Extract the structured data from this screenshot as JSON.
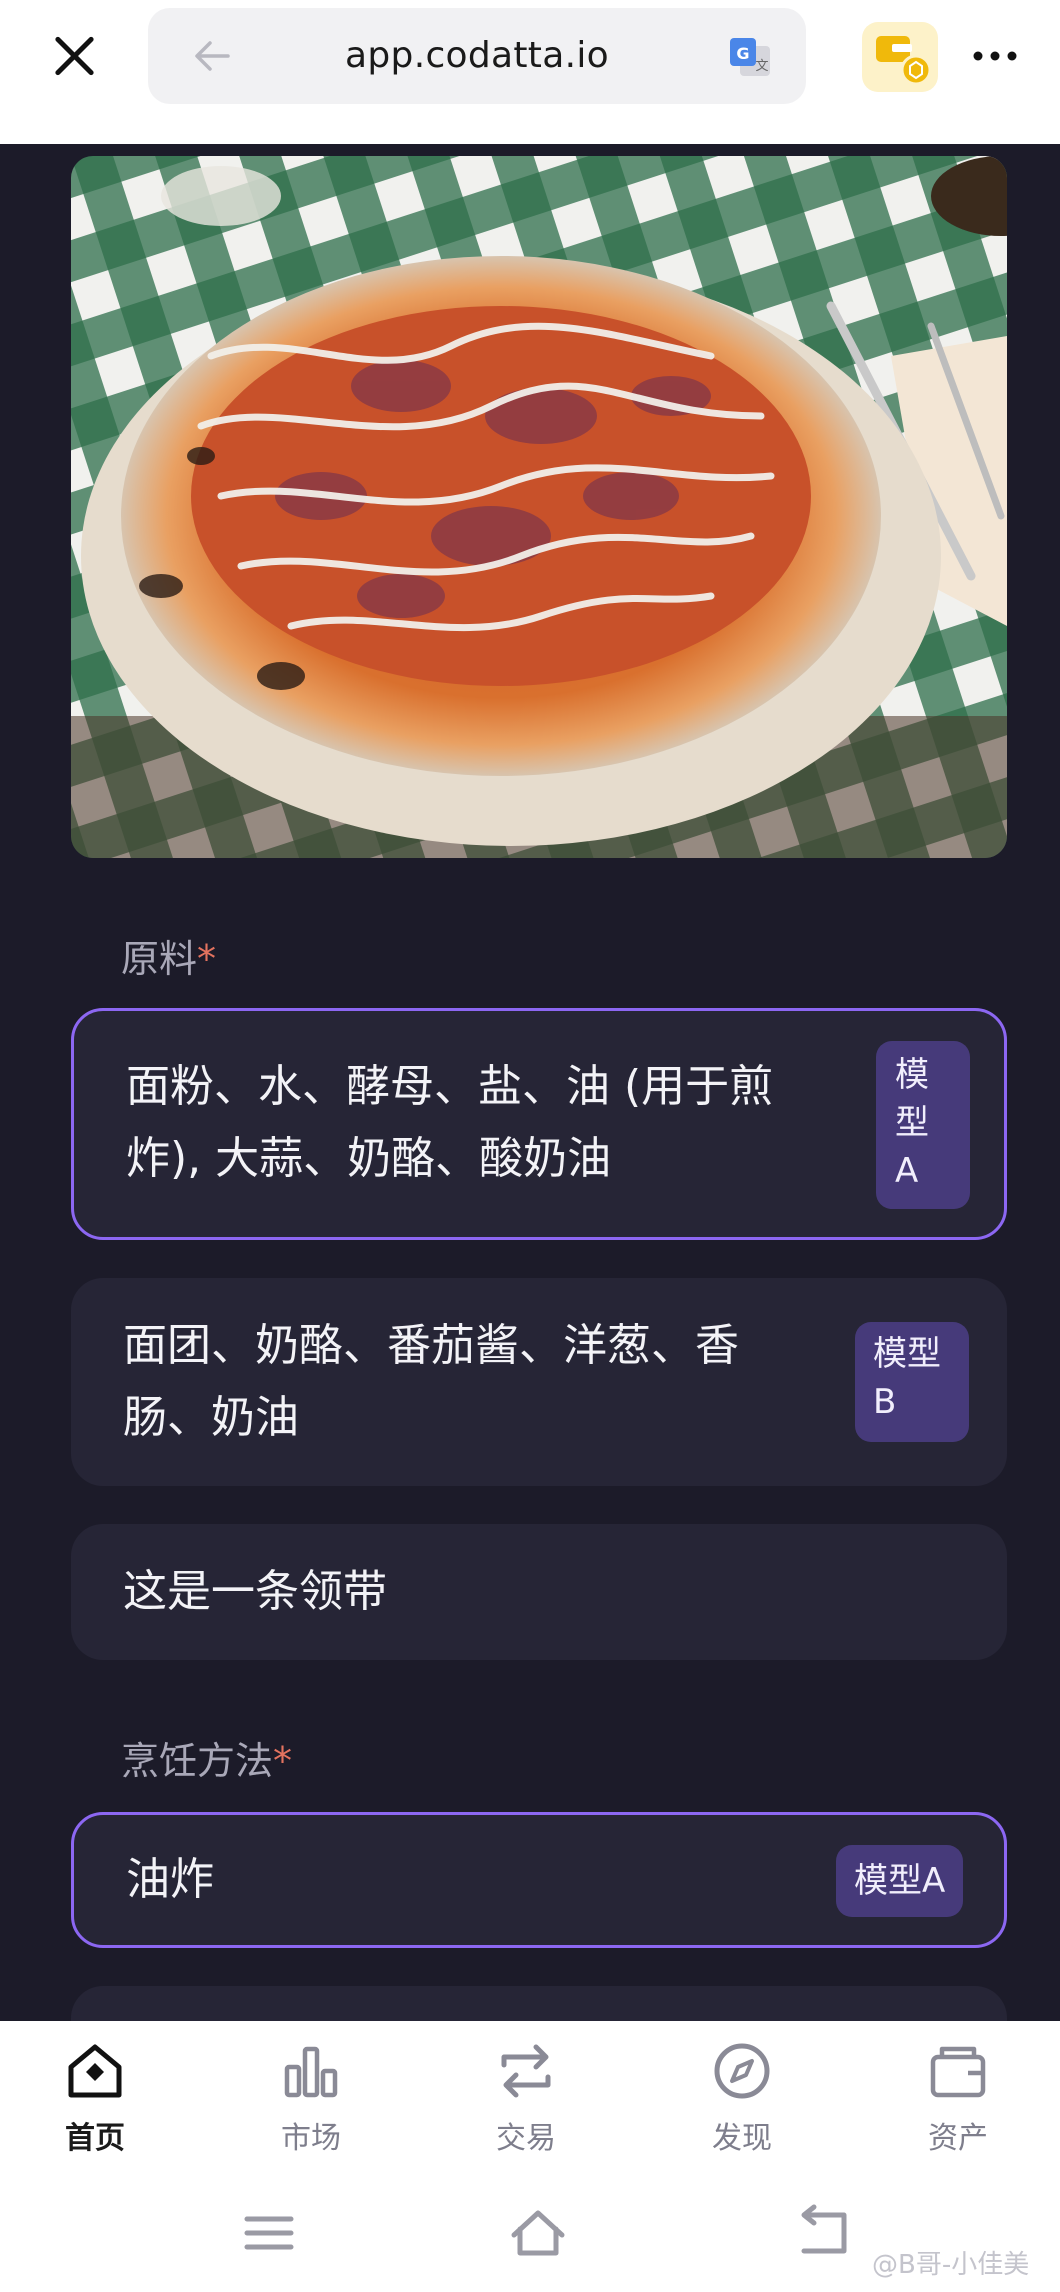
{
  "browser": {
    "url": "app.codatta.io"
  },
  "ingredients": {
    "label": "原料",
    "required_mark": "*",
    "options": [
      {
        "text_line1": "面粉、水、酵母、盐、油 (用于煎",
        "text_line2": "炸), 大蒜、奶酪、酸奶油",
        "badge_l1": "模",
        "badge_l2": "型",
        "badge_l3": "A",
        "selected": true
      },
      {
        "text_line1": "面团、奶酪、番茄酱、洋葱、香",
        "text_line2": "肠、奶油",
        "badge_l1": "模型",
        "badge_l2": "B",
        "selected": false
      },
      {
        "text_line1": "这是一条领带",
        "selected": false
      }
    ]
  },
  "cooking": {
    "label": "烹饪方法",
    "required_mark": "*",
    "options": [
      {
        "text": "油炸",
        "badge": "模型A",
        "selected": true
      }
    ]
  },
  "nav": {
    "items": [
      {
        "label": "首页",
        "icon": "home-icon",
        "active": true
      },
      {
        "label": "市场",
        "icon": "market-chart-icon",
        "active": false
      },
      {
        "label": "交易",
        "icon": "swap-icon",
        "active": false
      },
      {
        "label": "发现",
        "icon": "compass-icon",
        "active": false
      },
      {
        "label": "资产",
        "icon": "wallet-icon",
        "active": false
      }
    ]
  },
  "watermark": "@B哥-小佳美",
  "colors": {
    "accent": "#8c67f2",
    "required": "#e3735f",
    "card_bg": "#262536",
    "page_bg": "#1c1b29",
    "badge_bg": "#463a7a"
  }
}
